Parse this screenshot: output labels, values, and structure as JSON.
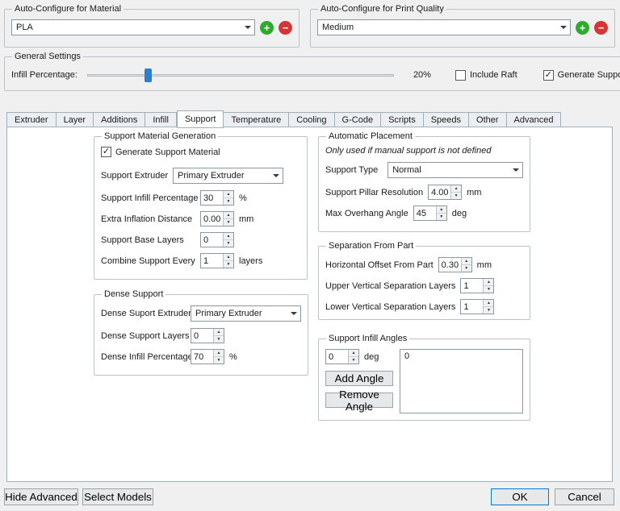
{
  "icons": {
    "plus": "+",
    "minus": "−",
    "check": "✓",
    "spin_up": "▲",
    "spin_down": "▼"
  },
  "colors": {
    "accent_blue": "#0078d7",
    "add_green": "#2eab2e",
    "remove_red": "#d63535",
    "slider_handle": "#2d7dd2"
  },
  "material_group": {
    "legend": "Auto-Configure for Material",
    "selected": "PLA"
  },
  "quality_group": {
    "legend": "Auto-Configure for Print Quality",
    "selected": "Medium"
  },
  "general": {
    "legend": "General Settings",
    "infill_label": "Infill Percentage:",
    "infill_value": "20%",
    "include_raft_label": "Include Raft",
    "generate_support_label": "Generate Support"
  },
  "tabs": {
    "labels": [
      "Extruder",
      "Layer",
      "Additions",
      "Infill",
      "Support",
      "Temperature",
      "Cooling",
      "G-Code",
      "Scripts",
      "Speeds",
      "Other",
      "Advanced"
    ],
    "active": "Support"
  },
  "support": {
    "generation": {
      "legend": "Support Material Generation",
      "generate_label": "Generate Support Material",
      "extruder_label": "Support Extruder",
      "extruder_value": "Primary Extruder",
      "infill_pct_label": "Support Infill Percentage",
      "infill_pct_value": "30",
      "infill_pct_unit": "%",
      "inflation_label": "Extra Inflation Distance",
      "inflation_value": "0.00",
      "inflation_unit": "mm",
      "base_layers_label": "Support Base Layers",
      "base_layers_value": "0",
      "combine_label": "Combine Support Every",
      "combine_value": "1",
      "combine_unit": "layers"
    },
    "dense": {
      "legend": "Dense Support",
      "extruder_label": "Dense Suport Extruder",
      "extruder_value": "Primary Extruder",
      "layers_label": "Dense Support Layers",
      "layers_value": "0",
      "infill_label": "Dense Infill Percentage",
      "infill_value": "70",
      "infill_unit": "%"
    },
    "auto_placement": {
      "legend": "Automatic Placement",
      "note": "Only used if manual support is not defined",
      "type_label": "Support Type",
      "type_value": "Normal",
      "pillar_label": "Support Pillar Resolution",
      "pillar_value": "4.00",
      "pillar_unit": "mm",
      "overhang_label": "Max Overhang Angle",
      "overhang_value": "45",
      "overhang_unit": "deg"
    },
    "separation": {
      "legend": "Separation From Part",
      "horizontal_label": "Horizontal Offset From Part",
      "horizontal_value": "0.30",
      "horizontal_unit": "mm",
      "upper_label": "Upper Vertical Separation Layers",
      "upper_value": "1",
      "lower_label": "Lower Vertical Separation Layers",
      "lower_value": "1"
    },
    "angles": {
      "legend": "Support Infill Angles",
      "angle_value": "0",
      "angle_unit": "deg",
      "add_button": "Add Angle",
      "remove_button": "Remove Angle",
      "list_items": [
        "0"
      ]
    }
  },
  "footer": {
    "hide_advanced": "Hide Advanced",
    "select_models": "Select Models",
    "ok": "OK",
    "cancel": "Cancel"
  }
}
